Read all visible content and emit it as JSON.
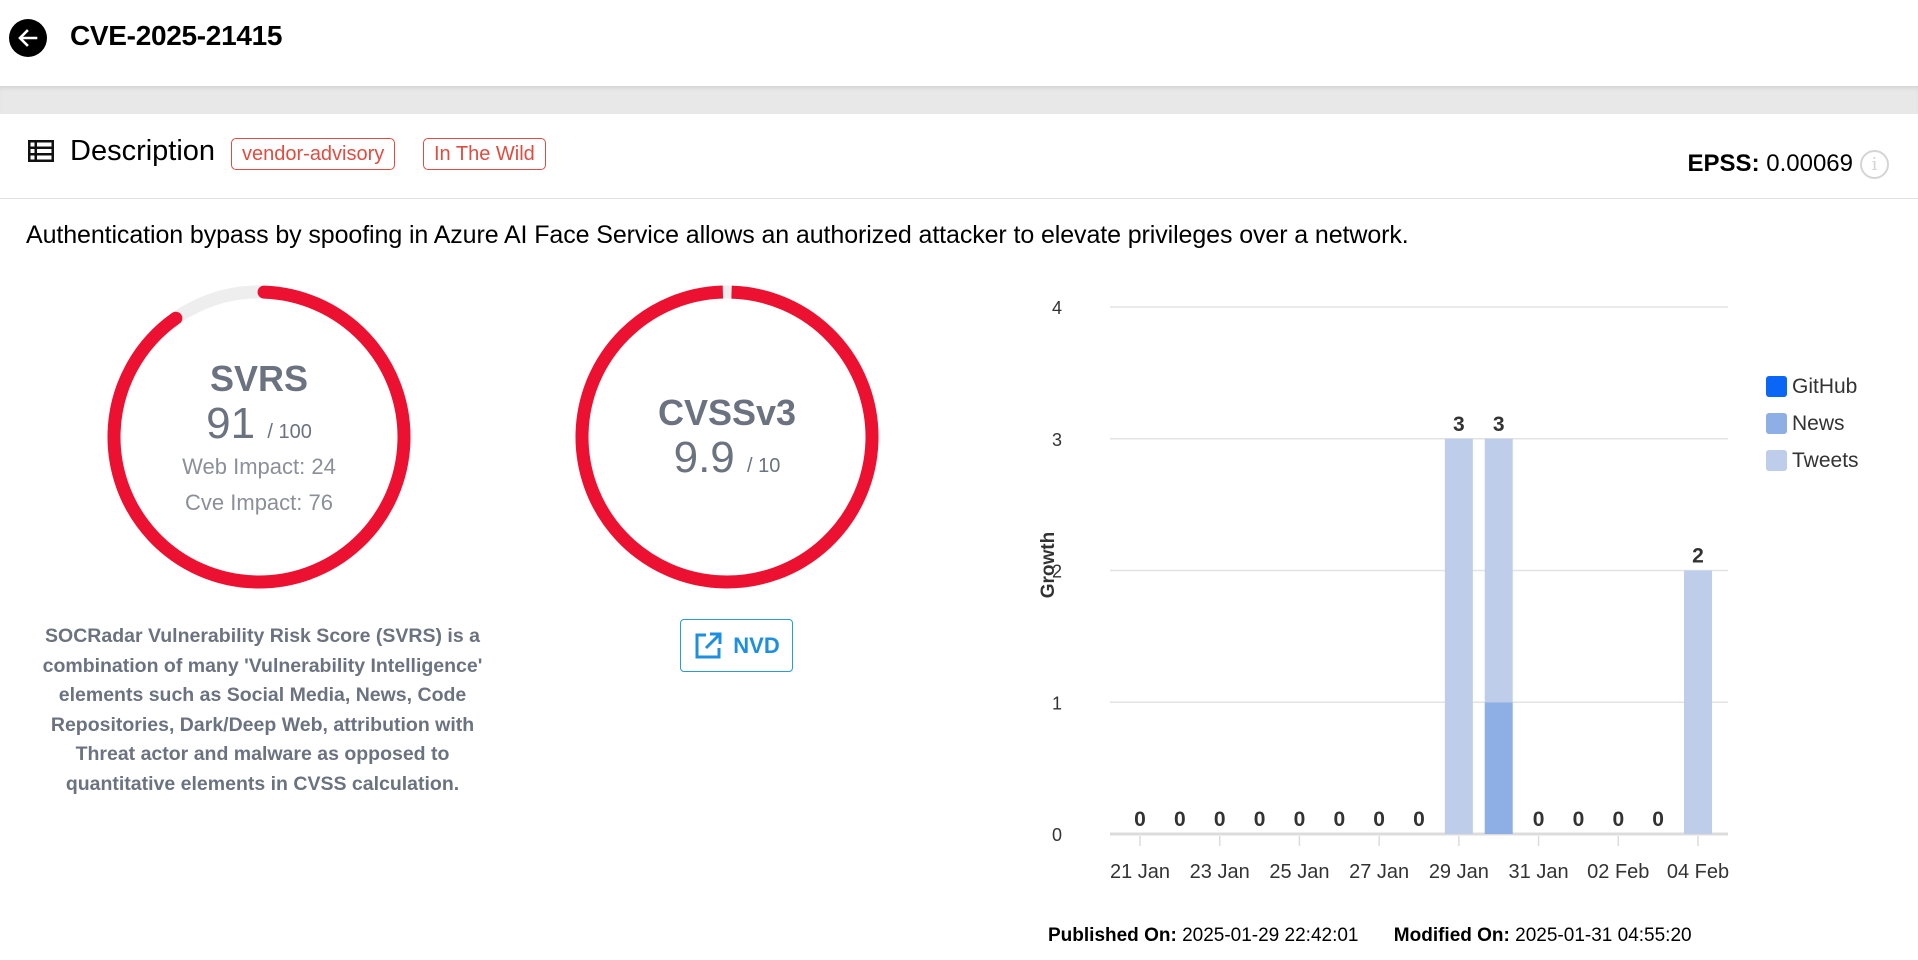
{
  "header": {
    "title": "CVE-2025-21415",
    "back_icon": "arrow-left-circle-icon"
  },
  "description": {
    "section_title": "Description",
    "section_icon": "list-icon",
    "tags": [
      "vendor-advisory",
      "In The Wild"
    ],
    "epss_label": "EPSS:",
    "epss_value": "0.00069",
    "info_icon": "info-icon",
    "text": "Authentication bypass by spoofing in Azure AI Face Service allows an authorized attacker to elevate privileges over a network."
  },
  "svrs": {
    "label": "SVRS",
    "score": "91",
    "max": "/ 100",
    "fraction": 0.91,
    "web_impact": "Web Impact: 24",
    "cve_impact": "Cve Impact: 76",
    "note": "SOCRadar Vulnerability Risk Score (SVRS) is a combination of many 'Vulnerability Intelligence' elements such as Social Media, News, Code Repositories, Dark/Deep Web, attribution with Threat actor and malware as opposed to quantitative elements in CVSS calculation."
  },
  "cvss": {
    "label": "CVSSv3",
    "score": "9.9",
    "max": "/ 10",
    "fraction": 0.99,
    "nvd_button": "NVD",
    "nvd_icon": "external-link-icon"
  },
  "colors": {
    "gauge_red": "#ec1131",
    "gauge_track": "#eeeeee",
    "tag_red": "#e24b3f",
    "link_blue": "#1e8fe0"
  },
  "footer": {
    "published_label": "Published On:",
    "published_value": "2025-01-29 22:42:01",
    "modified_label": "Modified On:",
    "modified_value": "2025-01-31 04:55:20"
  },
  "chart_data": {
    "type": "bar",
    "stacked": true,
    "title": "",
    "xlabel": "",
    "ylabel": "Growth",
    "ylim": [
      0,
      4
    ],
    "yticks": [
      0,
      1,
      2,
      3,
      4
    ],
    "grid": true,
    "legend_position": "right",
    "categories": [
      "21 Jan",
      "22 Jan",
      "23 Jan",
      "24 Jan",
      "25 Jan",
      "26 Jan",
      "27 Jan",
      "28 Jan",
      "29 Jan",
      "30 Jan",
      "31 Jan",
      "01 Feb",
      "02 Feb",
      "03 Feb",
      "04 Feb"
    ],
    "xtick_labels": [
      "21 Jan",
      "23 Jan",
      "25 Jan",
      "27 Jan",
      "29 Jan",
      "31 Jan",
      "02 Feb",
      "04 Feb"
    ],
    "series": [
      {
        "name": "GitHub",
        "color": "#0a66f5",
        "values": [
          0,
          0,
          0,
          0,
          0,
          0,
          0,
          0,
          0,
          0,
          0,
          0,
          0,
          0,
          0
        ]
      },
      {
        "name": "News",
        "color": "#8eaee6",
        "values": [
          0,
          0,
          0,
          0,
          0,
          0,
          0,
          0,
          0,
          1,
          0,
          0,
          0,
          0,
          0
        ]
      },
      {
        "name": "Tweets",
        "color": "#bdcdea",
        "values": [
          0,
          0,
          0,
          0,
          0,
          0,
          0,
          0,
          3,
          2,
          0,
          0,
          0,
          0,
          2
        ]
      }
    ],
    "totals": [
      0,
      0,
      0,
      0,
      0,
      0,
      0,
      0,
      3,
      3,
      0,
      0,
      0,
      0,
      2
    ]
  }
}
